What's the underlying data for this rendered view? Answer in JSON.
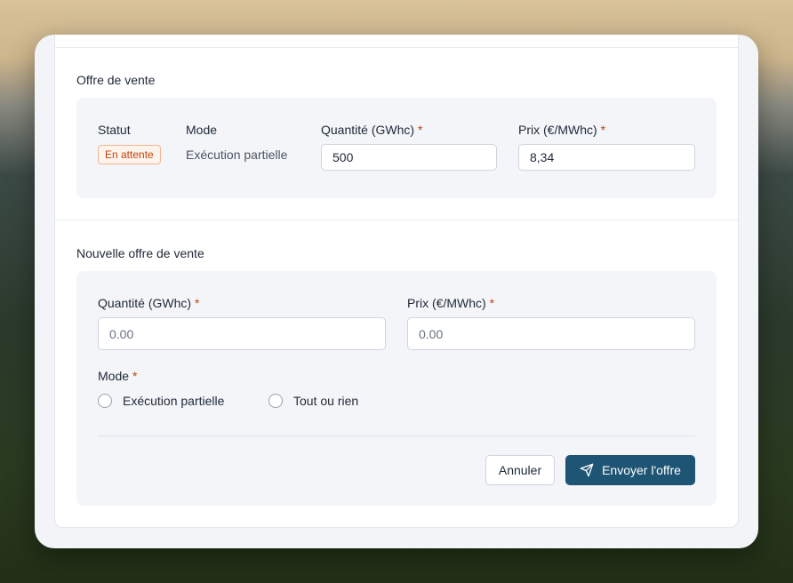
{
  "current_offer": {
    "title": "Offre de vente",
    "status_label": "Statut",
    "status_value": "En attente",
    "mode_label": "Mode",
    "mode_value": "Exécution partielle",
    "quantity_label": "Quantité (GWhc)",
    "quantity_value": "500",
    "price_label": "Prix (€/MWhc)",
    "price_value": "8,34",
    "required_mark": "*"
  },
  "new_offer": {
    "title": "Nouvelle offre de vente",
    "quantity_label": "Quantité (GWhc)",
    "quantity_placeholder": "0.00",
    "price_label": "Prix (€/MWhc)",
    "price_placeholder": "0.00",
    "mode_label": "Mode",
    "required_mark": "*",
    "mode_options": [
      "Exécution partielle",
      "Tout ou rien"
    ],
    "cancel_label": "Annuler",
    "submit_label": "Envoyer l'offre",
    "submit_icon": "send-icon"
  },
  "colors": {
    "accent": "#1e5474",
    "required": "#c2410c",
    "badge_border": "#f3b58f"
  }
}
